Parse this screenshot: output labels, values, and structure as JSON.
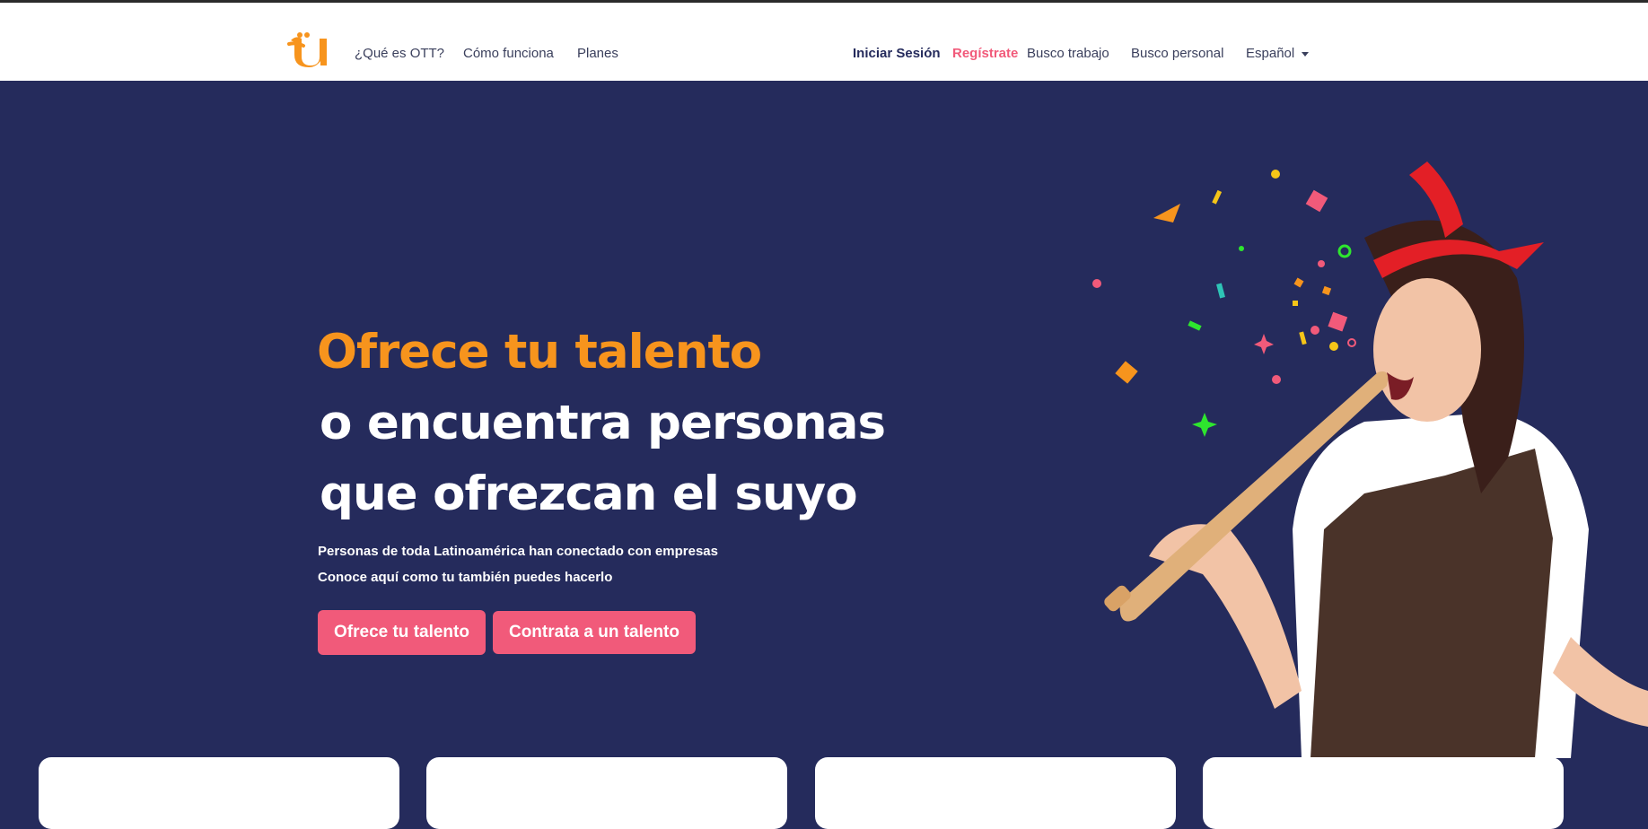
{
  "nav": {
    "logo_text": "tu",
    "links": [
      "¿Qué es OTT?",
      "Cómo funciona",
      "Planes"
    ],
    "login": "Iniciar Sesión",
    "register": "Regístrate",
    "job_seeker": "Busco trabajo",
    "employer": "Busco personal",
    "language": "Español"
  },
  "hero": {
    "title_line1": "Ofrece tu talento",
    "title_line2": "o encuentra personas",
    "title_line3": "que ofrezcan el suyo",
    "subtitle_line1": "Personas de toda Latinoamérica han conectado con empresas",
    "subtitle_line2": "Conoce aquí como tu también puedes hacerlo",
    "cta_primary": "Ofrece tu talento",
    "cta_secondary": "Contrata a un talento"
  },
  "colors": {
    "hero_bg": "#252b5c",
    "accent_orange": "#f7941d",
    "accent_pink": "#f15a7a"
  },
  "icons": {
    "logo": "ott-logo-icon",
    "language_caret": "caret-down-icon"
  }
}
